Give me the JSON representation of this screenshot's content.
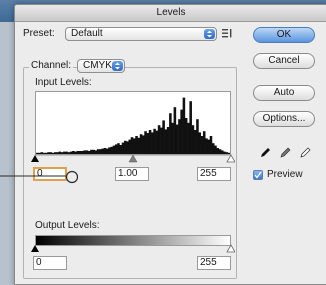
{
  "window": {
    "title": "Levels"
  },
  "preset": {
    "label": "Preset:",
    "value": "Default",
    "menu_icon": "list-menu-icon"
  },
  "channel": {
    "label": "Channel:",
    "value": "CMYK"
  },
  "input_levels": {
    "label": "Input Levels:",
    "black": "0",
    "gamma": "1.00",
    "white": "255",
    "histogram": [
      2,
      2,
      3,
      2,
      2,
      3,
      3,
      2,
      3,
      3,
      4,
      3,
      4,
      4,
      3,
      4,
      5,
      4,
      5,
      5,
      5,
      6,
      6,
      5,
      7,
      7,
      6,
      8,
      8,
      9,
      10,
      9,
      11,
      12,
      14,
      16,
      18,
      15,
      19,
      22,
      21,
      24,
      28,
      26,
      30,
      27,
      33,
      31,
      38,
      35,
      40,
      36,
      42,
      39,
      48,
      44,
      56,
      41,
      45,
      68,
      52,
      78,
      49,
      58,
      74,
      94,
      60,
      52,
      88,
      48,
      40,
      58,
      36,
      30,
      38,
      26,
      24,
      30,
      18,
      14,
      10,
      8,
      6,
      4,
      3,
      2
    ]
  },
  "output_levels": {
    "label": "Output Levels:",
    "black": "0",
    "white": "255"
  },
  "buttons": {
    "ok": "OK",
    "cancel": "Cancel",
    "auto": "Auto",
    "options": "Options..."
  },
  "preview": {
    "label": "Preview",
    "checked": true
  },
  "colors": {
    "accent": "#2f6cc8",
    "focus_ring": "#e0a050",
    "title_bar": "#d6d6d6"
  }
}
